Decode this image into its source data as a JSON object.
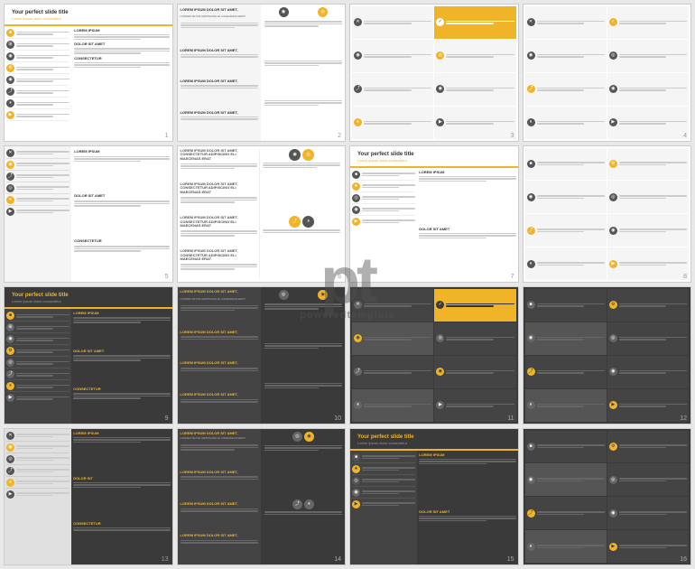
{
  "watermark": {
    "letters": "pt",
    "text": "poweredtemplate"
  },
  "slides": [
    {
      "id": 1,
      "number": "1",
      "theme": "white",
      "title": "Your perfect slide title",
      "subtitle": "Lorem ipsum dolor consectetur"
    },
    {
      "id": 2,
      "number": "2",
      "theme": "white",
      "title": "",
      "subtitle": ""
    },
    {
      "id": 3,
      "number": "3",
      "theme": "white",
      "title": "",
      "subtitle": ""
    },
    {
      "id": 4,
      "number": "4",
      "theme": "white",
      "title": "",
      "subtitle": ""
    },
    {
      "id": 5,
      "number": "5",
      "theme": "white",
      "title": "",
      "subtitle": ""
    },
    {
      "id": 6,
      "number": "6",
      "theme": "white",
      "title": "",
      "subtitle": ""
    },
    {
      "id": 7,
      "number": "7",
      "theme": "white",
      "title": "Your perfect slide title",
      "subtitle": "Lorem ipsum dolor consectetur"
    },
    {
      "id": 8,
      "number": "8",
      "theme": "white",
      "title": "",
      "subtitle": ""
    },
    {
      "id": 9,
      "number": "9",
      "theme": "dark",
      "title": "Your perfect slide title",
      "subtitle": "Lorem ipsum dolor consectetur"
    },
    {
      "id": 10,
      "number": "10",
      "theme": "dark",
      "title": "",
      "subtitle": ""
    },
    {
      "id": 11,
      "number": "11",
      "theme": "dark",
      "title": "",
      "subtitle": ""
    },
    {
      "id": 12,
      "number": "12",
      "theme": "dark",
      "title": "",
      "subtitle": ""
    },
    {
      "id": 13,
      "number": "13",
      "theme": "mixed",
      "title": "",
      "subtitle": ""
    },
    {
      "id": 14,
      "number": "14",
      "theme": "mixed",
      "title": "",
      "subtitle": ""
    },
    {
      "id": 15,
      "number": "15",
      "theme": "mixed-dark",
      "title": "Your perfect slide title",
      "subtitle": "Lorem ipsum dolor consectetur"
    },
    {
      "id": 16,
      "number": "16",
      "theme": "dark",
      "title": "",
      "subtitle": ""
    }
  ],
  "lorem": {
    "short": "LOREM IPSUM DOLOR SIT AMET,",
    "long": "CONSECTETUR ADIPISCING ELI MAECENAS ERAT",
    "body": "Lorem ipsum dolor sit amet, consectetur adipiscing elit. Maecenas erat.",
    "small": "Lorem ipsum dolor sit amet"
  },
  "icons": [
    "■",
    "⊞",
    "☰",
    "⚙",
    "✕",
    "✓",
    "◉",
    "★",
    "▶",
    "⏸",
    "♫",
    "◎"
  ]
}
